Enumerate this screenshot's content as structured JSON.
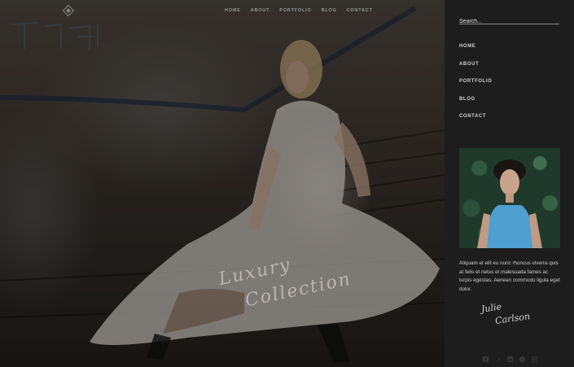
{
  "top_nav": {
    "items": [
      "HOME",
      "ABOUT",
      "PORTFOLIO",
      "BLOG",
      "CONTACT"
    ]
  },
  "hero": {
    "script_line_1": "Luxury",
    "script_line_2": "Collection"
  },
  "sidebar": {
    "search": {
      "placeholder": "Search..."
    },
    "menu": [
      "HOME",
      "ABOUT",
      "PORTFOLIO",
      "BLOG",
      "CONTACT"
    ],
    "bio": "Aliquam et elit eu nunc rhoncus viverra quis at felis et netus et malesuada fames ac turpis egestas. Aenean commodo ligula eget dolor.",
    "signature_line_1": "Julie",
    "signature_line_2": "Carlson",
    "social_icons": [
      "facebook-icon",
      "twitter-icon",
      "linkedin-icon",
      "pinterest-icon",
      "instagram-icon"
    ]
  }
}
